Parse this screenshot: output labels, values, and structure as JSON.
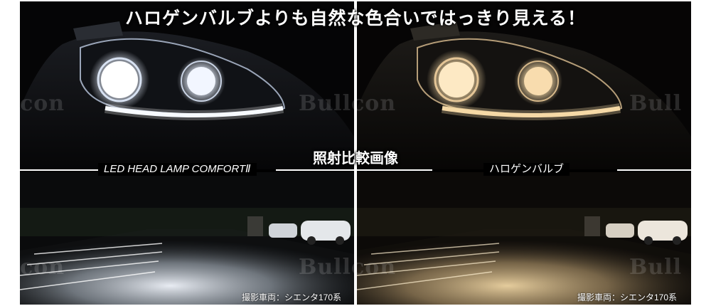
{
  "headline": "ハロゲンバルブよりも自然な色合いではっきり見える！",
  "comparison_label": "照射比較画像",
  "left_caption": "LED HEAD LAMP COMFORTⅡ",
  "right_caption": "ハロゲンバルブ",
  "vehicle_note": "撮影車両：シエンタ170系",
  "watermark": "Bullcon",
  "colors": {
    "led_light": "#f4f8ff",
    "halogen_light": "#f5d9a6",
    "background": "#000000"
  }
}
